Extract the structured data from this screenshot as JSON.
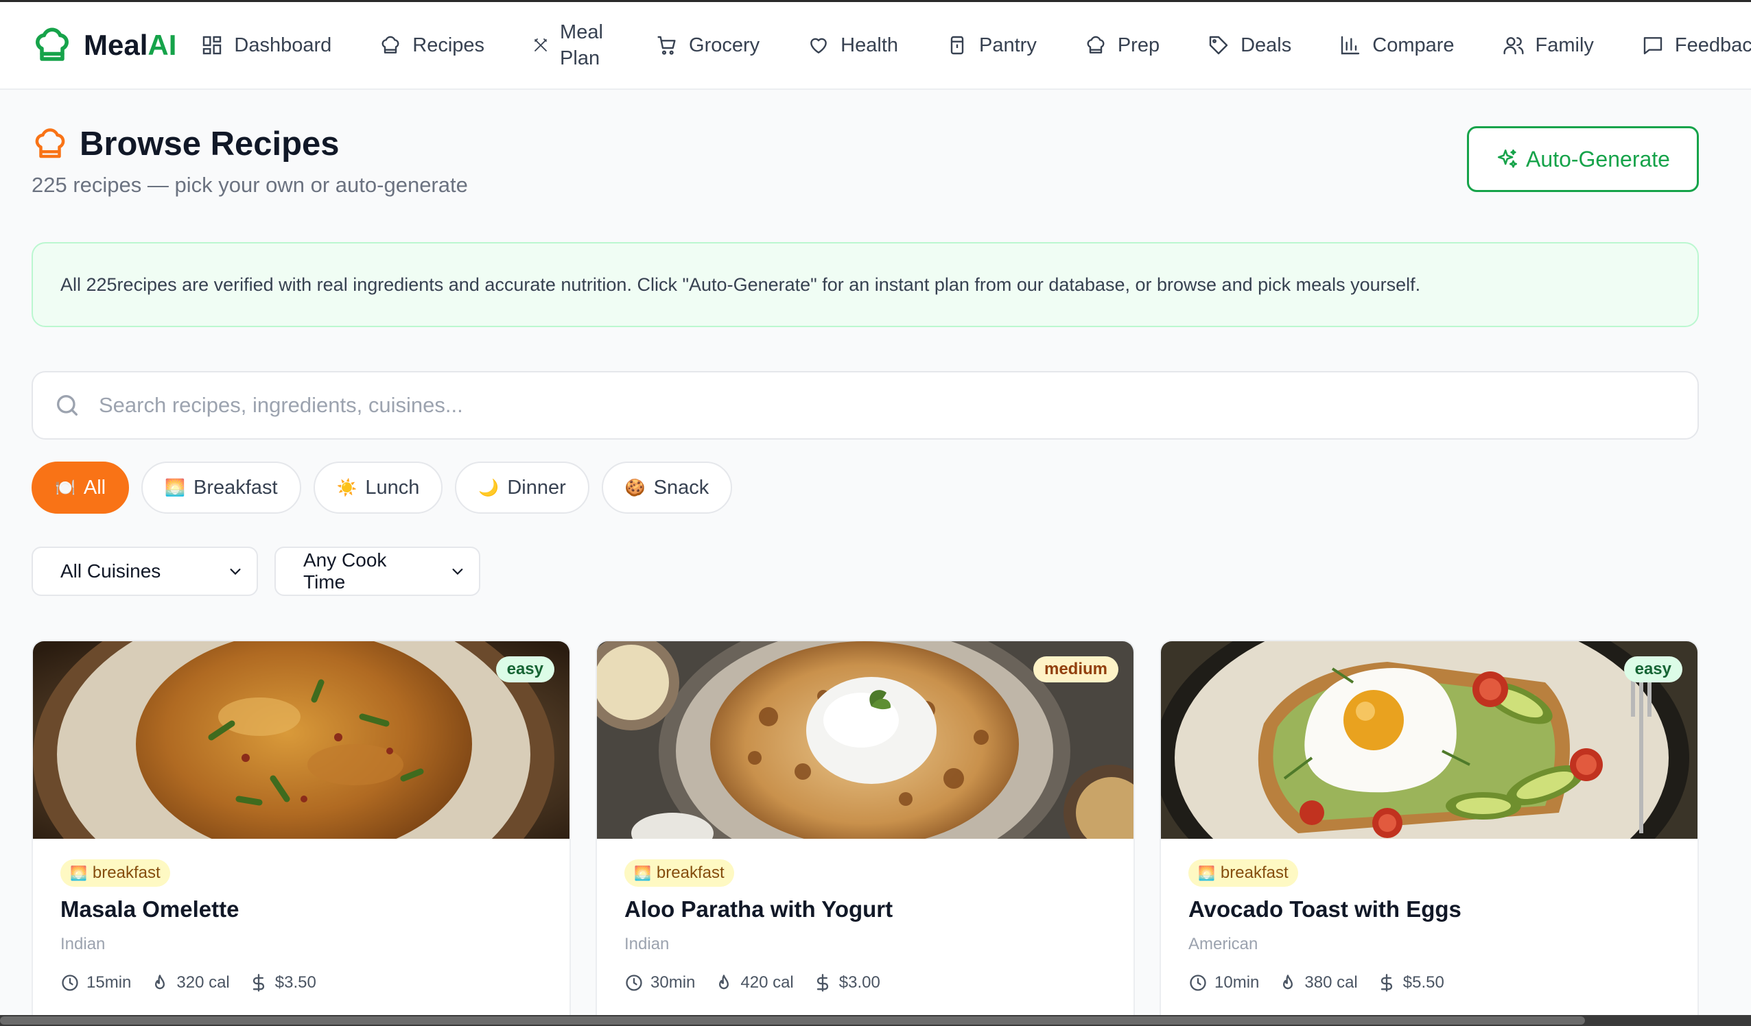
{
  "app": {
    "brand_a": "Meal",
    "brand_b": "AI"
  },
  "nav": [
    {
      "label": "Dashboard",
      "icon": "grid-icon"
    },
    {
      "label": "Recipes",
      "icon": "chef-hat-icon"
    },
    {
      "label": "Meal Plan",
      "icon": "utensils-icon"
    },
    {
      "label": "Grocery",
      "icon": "cart-icon"
    },
    {
      "label": "Health",
      "icon": "heart-icon"
    },
    {
      "label": "Pantry",
      "icon": "jar-icon"
    },
    {
      "label": "Prep",
      "icon": "chef-hat-icon"
    },
    {
      "label": "Deals",
      "icon": "tag-icon"
    },
    {
      "label": "Compare",
      "icon": "bar-chart-icon"
    },
    {
      "label": "Family",
      "icon": "users-icon"
    },
    {
      "label": "Feedback",
      "icon": "message-icon"
    }
  ],
  "header": {
    "title": "Browse Recipes",
    "subtitle": "225 recipes — pick your own or auto-generate",
    "autogen_label": "Auto-Generate"
  },
  "info": {
    "text": "All 225recipes are verified with real ingredients and accurate nutrition. Click \"Auto-Generate\" for an instant plan from our database, or browse and pick meals yourself."
  },
  "search": {
    "placeholder": "Search recipes, ingredients, cuisines...",
    "value": ""
  },
  "filters": {
    "chips": [
      {
        "emoji": "🍽️",
        "label": "All",
        "active": true
      },
      {
        "emoji": "🌅",
        "label": "Breakfast",
        "active": false
      },
      {
        "emoji": "☀️",
        "label": "Lunch",
        "active": false
      },
      {
        "emoji": "🌙",
        "label": "Dinner",
        "active": false
      },
      {
        "emoji": "🍪",
        "label": "Snack",
        "active": false
      }
    ],
    "cuisine_select": "All Cuisines",
    "time_select": "Any Cook Time"
  },
  "recipes": [
    {
      "name": "Masala Omelette",
      "cuisine": "Indian",
      "meal": "breakfast",
      "meal_emoji": "🌅",
      "difficulty": "easy",
      "time": "15min",
      "calories": "320 cal",
      "cost": "$3.50"
    },
    {
      "name": "Aloo Paratha with Yogurt",
      "cuisine": "Indian",
      "meal": "breakfast",
      "meal_emoji": "🌅",
      "difficulty": "medium",
      "time": "30min",
      "calories": "420 cal",
      "cost": "$3.00"
    },
    {
      "name": "Avocado Toast with Eggs",
      "cuisine": "American",
      "meal": "breakfast",
      "meal_emoji": "🌅",
      "difficulty": "easy",
      "time": "10min",
      "calories": "380 cal",
      "cost": "$5.50"
    }
  ],
  "colors": {
    "brand_green": "#16a34a",
    "accent_orange": "#f97316"
  }
}
